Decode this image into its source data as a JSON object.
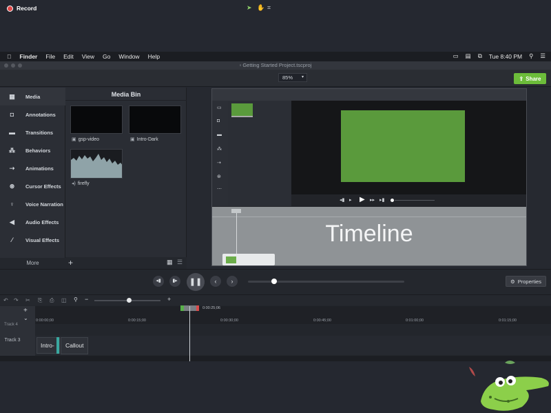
{
  "menubar": {
    "apple_icon": "apple-icon",
    "items": [
      "Finder",
      "File",
      "Edit",
      "View",
      "Go",
      "Window",
      "Help"
    ],
    "clock": "Tue 8:40 PM"
  },
  "window": {
    "title": "Getting Started Project.tscproj"
  },
  "toolbar": {
    "record_label": "Record",
    "zoom_value": "85%",
    "share_label": "Share"
  },
  "sidebar": {
    "items": [
      {
        "label": "Media",
        "icon": "film-icon"
      },
      {
        "label": "Annotations",
        "icon": "annotation-icon"
      },
      {
        "label": "Transitions",
        "icon": "transition-icon"
      },
      {
        "label": "Behaviors",
        "icon": "behavior-icon"
      },
      {
        "label": "Animations",
        "icon": "animation-icon"
      },
      {
        "label": "Cursor Effects",
        "icon": "cursor-icon"
      },
      {
        "label": "Voice Narration",
        "icon": "microphone-icon"
      },
      {
        "label": "Audio Effects",
        "icon": "speaker-icon"
      },
      {
        "label": "Visual Effects",
        "icon": "wand-icon"
      }
    ],
    "more_label": "More"
  },
  "media_bin": {
    "title": "Media Bin",
    "items": [
      {
        "name": "gsp-video",
        "type": "video"
      },
      {
        "name": "Intro-Dark",
        "type": "video"
      },
      {
        "name": "firefly",
        "type": "audio"
      }
    ]
  },
  "overlay": {
    "text": "Timeline"
  },
  "properties_label": "Properties",
  "timeline": {
    "playhead_time": "0:00:25;06",
    "ruler_labels": [
      "0:00:00;00",
      "0:00:15;00",
      "0:00:30;00",
      "0:00:45;00",
      "0:01:00;00",
      "0:01:15;00"
    ],
    "track4_label": "Track 4",
    "track3_label": "Track 3",
    "clips": [
      "Intro-",
      "Callout"
    ]
  },
  "colors": {
    "accent_green": "#6cbc3a",
    "record_red": "#e04848",
    "canvas_green": "#5a9a3c"
  }
}
